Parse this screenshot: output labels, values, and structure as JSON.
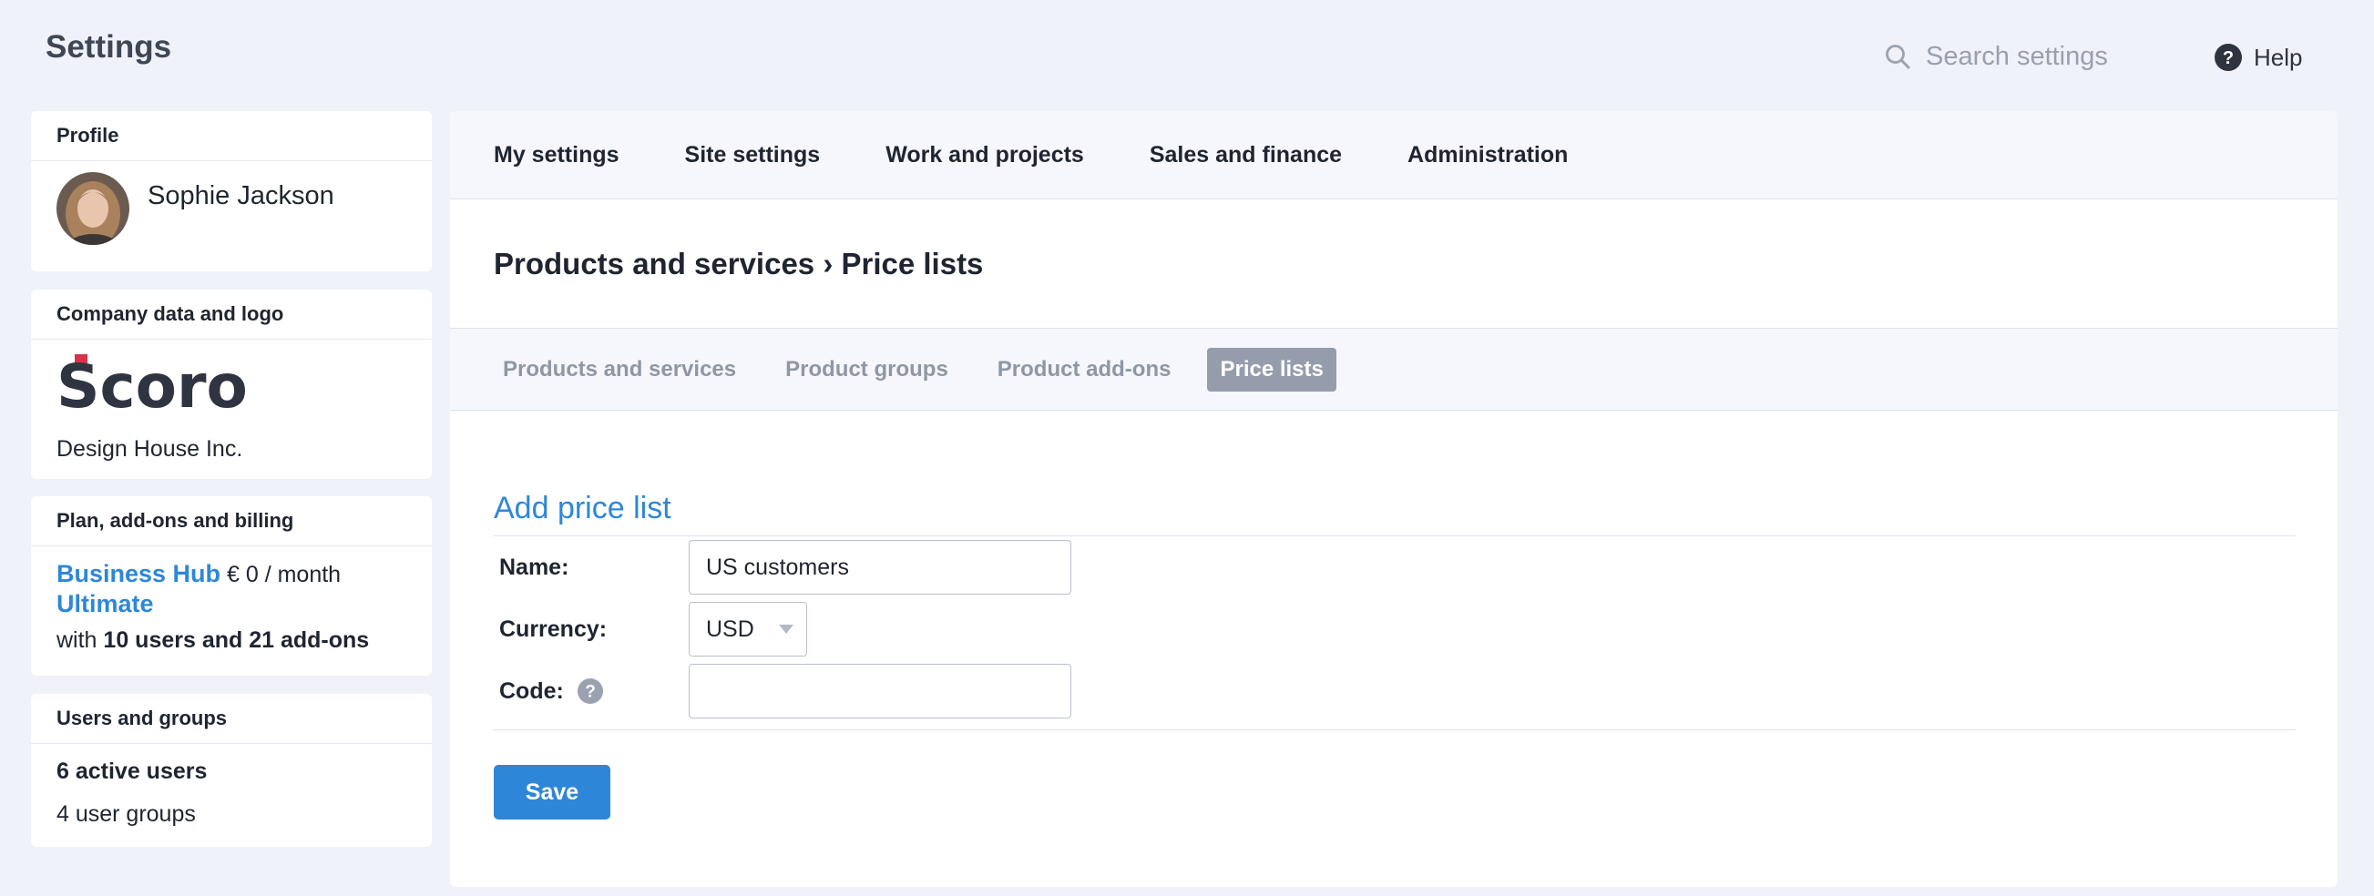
{
  "app": {
    "title": "Settings",
    "search": {
      "placeholder": "Search settings",
      "value": ""
    },
    "help_label": "Help"
  },
  "sidebar": {
    "profile": {
      "heading": "Profile",
      "name": "Sophie Jackson"
    },
    "company": {
      "heading": "Company data and logo",
      "logo_text": "Scoro",
      "name": "Design House Inc."
    },
    "plan": {
      "heading": "Plan, add-ons and billing",
      "plan_name": "Business Hub",
      "price": "€ 0 / month",
      "tier": "Ultimate",
      "with_label": "with",
      "summary": "10 users and 21 add-ons"
    },
    "users": {
      "heading": "Users and groups",
      "active": "6 active users",
      "groups": "4 user groups"
    }
  },
  "main": {
    "nav": [
      "My settings",
      "Site settings",
      "Work and projects",
      "Sales and finance",
      "Administration"
    ],
    "breadcrumb": "Products and services › Price lists",
    "subtabs": [
      {
        "label": "Products and services",
        "active": false
      },
      {
        "label": "Product groups",
        "active": false
      },
      {
        "label": "Product add-ons",
        "active": false
      },
      {
        "label": "Price lists",
        "active": true
      }
    ],
    "form": {
      "title": "Add price list",
      "name_label": "Name:",
      "name_value": "US customers",
      "currency_label": "Currency:",
      "currency_value": "USD",
      "code_label": "Code:",
      "code_value": "",
      "save_label": "Save"
    }
  },
  "colors": {
    "accent": "#2e86d9",
    "link": "#2d87d8",
    "active_tab": "#959cab",
    "page_bg": "#eff2f9",
    "logo_dark": "#2f3441",
    "logo_red": "#d6334a"
  },
  "icons": {
    "search": "search-icon",
    "help": "help-circle-icon",
    "code_help": "question-icon",
    "currency_dropdown": "caret-down-icon"
  }
}
